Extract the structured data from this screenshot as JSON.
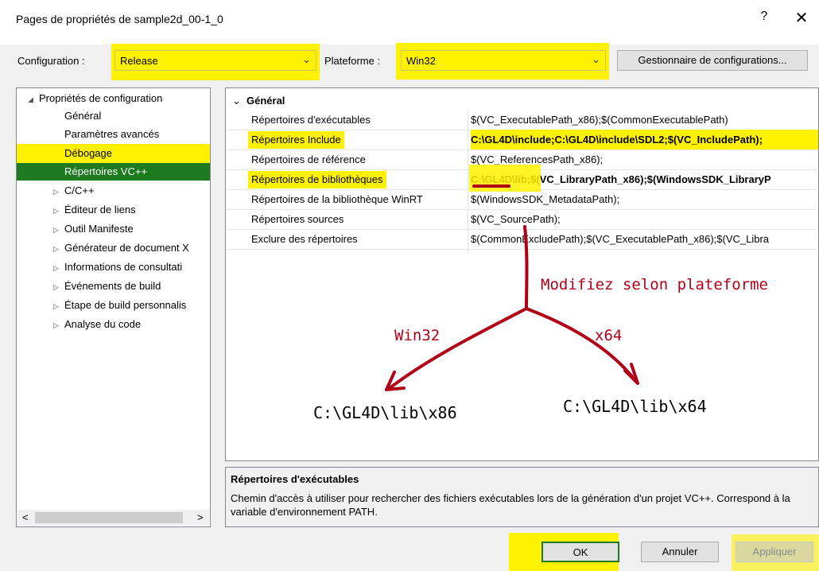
{
  "window": {
    "title": "Pages de propriétés de sample2d_00-1_0",
    "help": "?",
    "close": "✕"
  },
  "config": {
    "config_label": "Configuration :",
    "config_value": "Release",
    "platform_label": "Plateforme :",
    "platform_value": "Win32",
    "manager_button": "Gestionnaire de configurations..."
  },
  "tree": {
    "root": "Propriétés de configuration",
    "items": [
      {
        "label": "Général"
      },
      {
        "label": "Paramètres avancés"
      },
      {
        "label": "Débogage"
      },
      {
        "label": "Répertoires VC++"
      },
      {
        "label": "C/C++"
      },
      {
        "label": "Éditeur de liens"
      },
      {
        "label": "Outil Manifeste"
      },
      {
        "label": "Générateur de document X"
      },
      {
        "label": "Informations de consultati"
      },
      {
        "label": "Événements de build"
      },
      {
        "label": "Étape de build personnalis"
      },
      {
        "label": "Analyse du code"
      }
    ],
    "scroll_left": "<",
    "scroll_right": ">"
  },
  "grid": {
    "section": "Général",
    "rows": [
      {
        "name": "Répertoires d'exécutables",
        "value": "$(VC_ExecutablePath_x86);$(CommonExecutablePath)"
      },
      {
        "name": "Répertoires Include",
        "value": "C:\\GL4D\\include;C:\\GL4D\\include\\SDL2;$(VC_IncludePath);"
      },
      {
        "name": "Répertoires de référence",
        "value": "$(VC_ReferencesPath_x86);"
      },
      {
        "name": "Répertoires de bibliothèques",
        "value": "C:\\GL4D\\lib;$(VC_LibraryPath_x86);$(WindowsSDK_LibraryP"
      },
      {
        "name": "Répertoires de la bibliothèque WinRT",
        "value": "$(WindowsSDK_MetadataPath);"
      },
      {
        "name": "Répertoires sources",
        "value": "$(VC_SourcePath);"
      },
      {
        "name": "Exclure des répertoires",
        "value": "$(CommonExcludePath);$(VC_ExecutablePath_x86);$(VC_Libra"
      }
    ]
  },
  "annotation": {
    "main": "Modifiez selon plateforme",
    "left_label": "Win32",
    "right_label": "x64",
    "left_path": "C:\\GL4D\\lib\\x86",
    "right_path": "C:\\GL4D\\lib\\x64",
    "color": "#b00018"
  },
  "description": {
    "title": "Répertoires d'exécutables",
    "text": "Chemin d'accès à utiliser pour rechercher des fichiers exécutables lors de la génération d'un projet VC++. Correspond à la variable d'environnement PATH."
  },
  "buttons": {
    "ok": "OK",
    "cancel": "Annuler",
    "apply": "Appliquer"
  }
}
